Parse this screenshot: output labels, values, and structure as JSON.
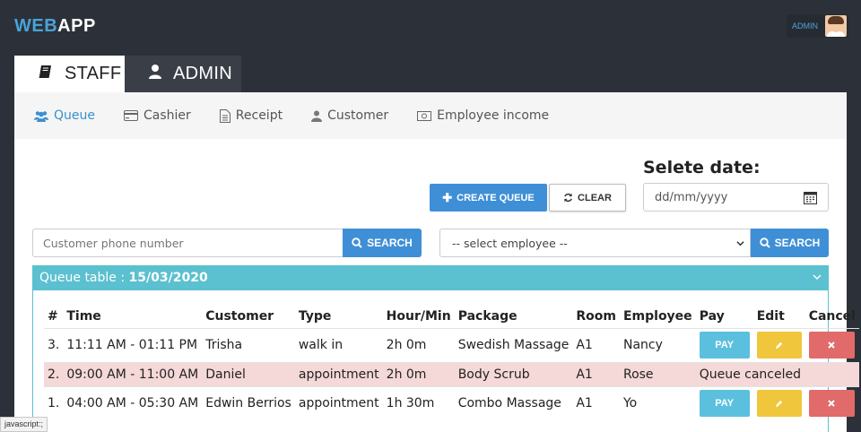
{
  "brand": {
    "part1": "WEB",
    "part2": "APP"
  },
  "user": {
    "name": "ADMIN"
  },
  "main_tabs": [
    {
      "label": "STAFF",
      "icon": "book-icon",
      "active": true
    },
    {
      "label": "ADMIN",
      "icon": "user-icon",
      "active": false
    }
  ],
  "sub_nav": [
    {
      "label": "Queue",
      "icon": "users-icon",
      "active": true
    },
    {
      "label": "Cashier",
      "icon": "credit-card-icon"
    },
    {
      "label": "Receipt",
      "icon": "file-icon"
    },
    {
      "label": "Customer",
      "icon": "user-icon"
    },
    {
      "label": "Employee income",
      "icon": "money-icon"
    }
  ],
  "date_title": "Selete date:",
  "date_placeholder": "dd/mm/yyyy",
  "create_label": "CREATE QUEUE",
  "clear_label": "CLEAR",
  "phone_placeholder": "Customer phone number",
  "search_label": "SEARCH",
  "employee_select": "-- select employee --",
  "queue": {
    "title_prefix": "Queue table : ",
    "date": "15/03/2020",
    "columns": [
      "#",
      "Time",
      "Customer",
      "Type",
      "Hour/Min",
      "Package",
      "Room",
      "Employee",
      "Pay",
      "Edit",
      "Cancel"
    ],
    "rows": [
      {
        "num": "3.",
        "time": "11:11 AM - 01:11 PM",
        "customer": "Trisha",
        "type": "walk in",
        "duration": "2h 0m",
        "package": "Swedish Massage",
        "room": "A1",
        "employee": "Nancy",
        "pay": "PAY",
        "canceled": false
      },
      {
        "num": "2.",
        "time": "09:00 AM - 11:00 AM",
        "customer": "Daniel",
        "type": "appointment",
        "duration": "2h 0m",
        "package": "Body Scrub",
        "room": "A1",
        "employee": "Rose",
        "status": "Queue canceled",
        "canceled": true
      },
      {
        "num": "1.",
        "time": "04:00 AM - 05:30 AM",
        "customer": "Edwin Berrios",
        "type": "appointment",
        "duration": "1h 30m",
        "package": "Combo Massage",
        "room": "A1",
        "employee": "Yo",
        "pay": "PAY",
        "canceled": false
      }
    ]
  },
  "status_bar": "javascript:;",
  "colors": {
    "brand_blue": "#4aa3d8",
    "primary": "#3f8fd6",
    "teal": "#5bc0cf",
    "warning": "#f0c63c",
    "danger": "#e16a6a",
    "canceled_row": "#f5d8d8",
    "dark_bg": "#2c3139"
  }
}
